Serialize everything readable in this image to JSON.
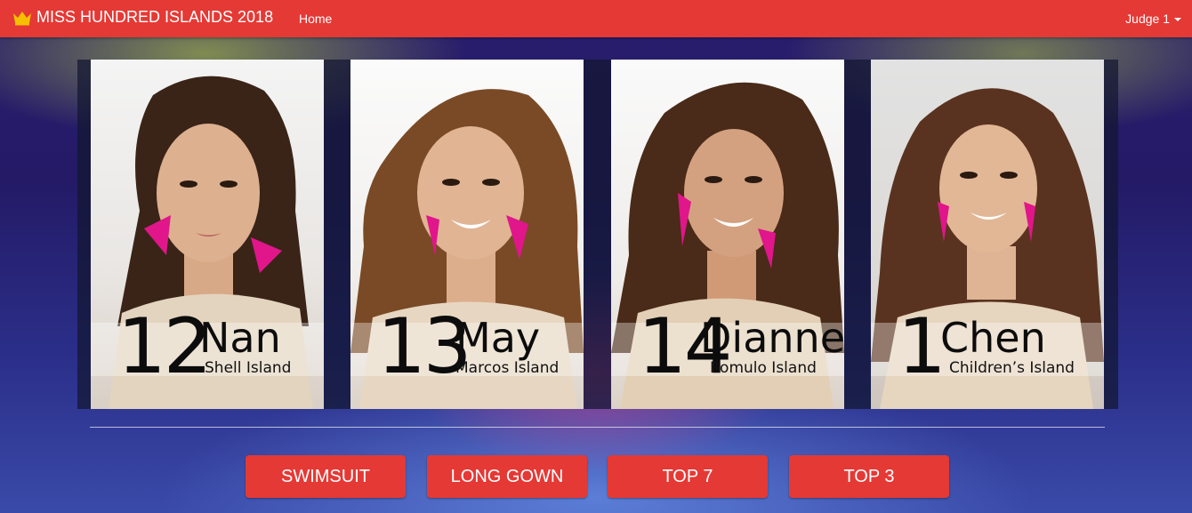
{
  "navbar": {
    "brand": "MISS HUNDRED ISLANDS 2018",
    "home": "Home",
    "user": "Judge 1"
  },
  "candidates": [
    {
      "number": "12",
      "name": "Nan",
      "island": "Shell Island"
    },
    {
      "number": "13",
      "name": "May",
      "island": "Marcos Island"
    },
    {
      "number": "14",
      "name": "Dianne",
      "island": "Romulo Island"
    },
    {
      "number": "1",
      "name": "Chen",
      "island": "Children’s Island"
    }
  ],
  "categories": [
    "SWIMSUIT",
    "LONG GOWN",
    "TOP 7",
    "TOP 3"
  ],
  "colors": {
    "primary": "#e53935",
    "crown": "#f5c000",
    "earring": "#e0168a"
  },
  "icons": {
    "brand": "crown-icon",
    "dropdown": "caret-down-icon"
  }
}
